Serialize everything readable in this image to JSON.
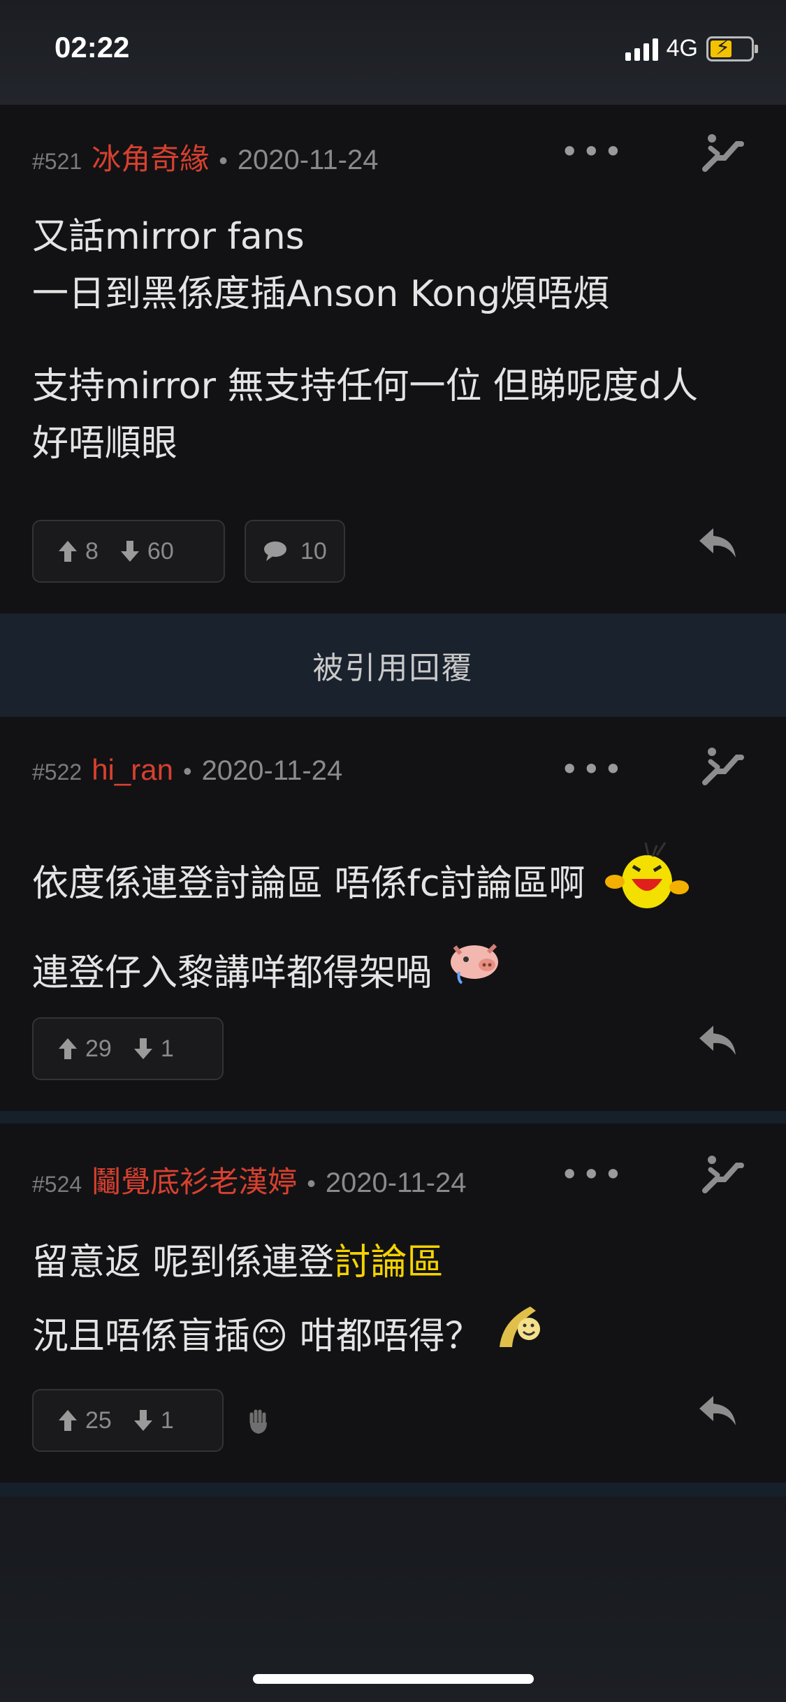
{
  "status": {
    "time": "02:22",
    "network": "4G"
  },
  "posts": [
    {
      "num": "#521",
      "author": "冰角奇緣",
      "date": "2020-11-24",
      "lines": [
        "又話mirror fans",
        "一日到黑係度插Anson Kong煩唔煩",
        "支持mirror 無支持任何一位 但睇呢度d人",
        "好唔順眼"
      ],
      "up": "8",
      "down": "60",
      "comments": "10"
    },
    {
      "num": "#522",
      "author": "hi_ran",
      "date": "2020-11-24",
      "lines": [
        "依度係連登討論區 唔係fc討論區啊",
        "連登仔入黎講咩都得架喎"
      ],
      "up": "29",
      "down": "1"
    },
    {
      "num": "#524",
      "author": "鬮覺底衫老漢婷",
      "date": "2020-11-24",
      "line1_prefix": "留意返 呢到係連登",
      "line1_highlight": "討論區",
      "line2_a": "況且唔係盲插",
      "line2_b": " 咁都唔得？",
      "up": "25",
      "down": "1"
    }
  ],
  "quoted_bar": {
    "label": "被引用回覆"
  },
  "dot": "•",
  "more": "•••",
  "emoji": {
    "smile": "😊"
  },
  "colors": {
    "author": "#d8402f",
    "highlight": "#f5d300",
    "background": "#121214"
  }
}
